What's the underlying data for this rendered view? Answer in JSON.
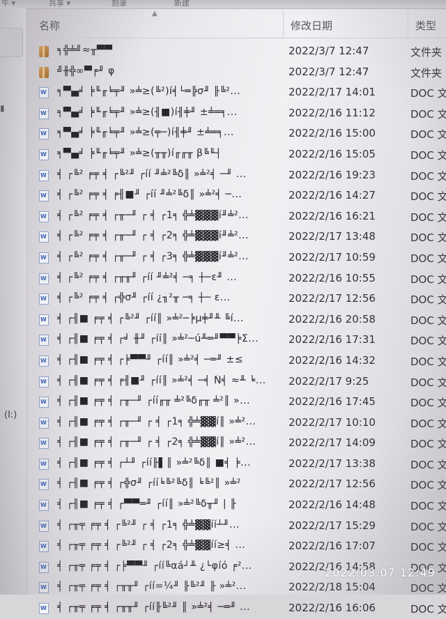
{
  "toolbar": {
    "left_label": "牛 ▾",
    "mid_label": "共享 ▾",
    "mid2_label": "刻录",
    "mid3_label": "新建"
  },
  "nav": {
    "drive_label": "(I:)",
    "mark": "▮"
  },
  "header": {
    "name": "名称",
    "date": "修改日期",
    "type": "类型",
    "sort": "▲"
  },
  "rows": [
    {
      "icon": "folder",
      "name": "╕╬╧╝≈╥▀▀",
      "date": "2022/3/7 12:47",
      "type": "文件夹"
    },
    {
      "icon": "folder",
      "name": "╝╫╬∞▀╒╜ φ",
      "date": "2022/3/7 12:47",
      "type": "文件夹"
    },
    {
      "icon": "doc",
      "name": "╕▀▄╛ ╞╙╓╘╤╜ »╧≥(╚²)í╡└═╠σ╜ ╟╚²...",
      "date": "2022/2/17 14:01",
      "type": "DOC 文档"
    },
    {
      "icon": "doc",
      "name": "╕▀▄╛ ╞╙╓╘╤╜ »╧≥(╢■)í╢╪╜ ±╧═╕...",
      "date": "2022/2/16 11:12",
      "type": "DOC 文档"
    },
    {
      "icon": "doc",
      "name": "╕▀▄╛ ╞╙╓╘╤╜ »╧≥(╤─)í╢╪╜ ±╧═╕...",
      "date": "2022/2/16 15:00",
      "type": "DOC 文档"
    },
    {
      "icon": "doc",
      "name": "╕▀▄╛ ╞╙╓╘╤╜ »╧≥(╥╥)í╓╓╥ β╚╙┤",
      "date": "2022/2/16 15:05",
      "type": "DOC 文档"
    },
    {
      "icon": "doc",
      "name": "╡ ┌╚² ╒╤ ╡ ┌╚²╜ ┌íí ╜╧²╚δ║ »╧²╡ ─╜ ...",
      "date": "2022/2/16 19:23",
      "type": "DOC 文档"
    },
    {
      "icon": "doc",
      "name": "╡ ┌╚² ╒╤ ╡ ╒╢■╜ ┌íí ╜╧²╚δ║ »╧²╡ ─...",
      "date": "2022/2/16 14:27",
      "type": "DOC 文档"
    },
    {
      "icon": "doc",
      "name": "╡ ┌╚² ╒╤ ╡ ┌╥─╜ ┌ ╡ ┌1╕ ╬╧▓▓▓í╜╧²...",
      "date": "2022/2/16 16:21",
      "type": "DOC 文档"
    },
    {
      "icon": "doc",
      "name": "╡ ┌╚² ╒╤ ╡ ┌╥─╜ ┌ ╡ ┌2╕ ╬╧▓▓▓í╜╧²...",
      "date": "2022/2/17 13:48",
      "type": "DOC 文档"
    },
    {
      "icon": "doc",
      "name": "╡ ┌╚² ╒╤ ╡ ┌╥─╜ ┌ ╡ ┌3╕ ╬╧▓▓▓í╜╧²...",
      "date": "2022/2/17 10:59",
      "type": "DOC 文档"
    },
    {
      "icon": "doc",
      "name": "╡ ┌╚² ╒╤ ╡ ┌╥╥╜ ┌íí ╜╧²╡ ─╕ ┼─ε╜ ...",
      "date": "2022/2/16 10:55",
      "type": "DOC 文档"
    },
    {
      "icon": "doc",
      "name": "╡ ┌╚² ╒╤ ╡ ┌╬σ╜ ┌íí ¿╖²╥ ─╕ ┼─ ε...",
      "date": "2022/2/17 12:56",
      "type": "DOC 文档"
    },
    {
      "icon": "doc",
      "name": "╡ ┌╢■ ╒╤ ╡ ┌╚²╜ ┌íí║ »╧²─╞µ╪╜╨ ╚í...",
      "date": "2022/2/16 20:58",
      "type": "DOC 文档"
    },
    {
      "icon": "doc",
      "name": "╡ ┌╢■ ╒╤ ╡ ┌╛ ╫╜ ┌íí║ »╧²─ú╨═╜▀▀╞Σ...",
      "date": "2022/2/16 17:31",
      "type": "DOC 文档"
    },
    {
      "icon": "doc",
      "name": "╡ ┌╢■ ╒╤ ╡ ┌╞▀▀╜ ┌íí║ »╧²╡ ─═╜ ±≤",
      "date": "2022/2/16 14:32",
      "type": "DOC 文档"
    },
    {
      "icon": "doc",
      "name": "╡ ┌╢■ ╒╤ ╡ ╒╢■╜ ┌íí║ »╧²╡ ─╡ Ñ╡ ≈╨ ╘...",
      "date": "2022/2/17 9:25",
      "type": "DOC 文档"
    },
    {
      "icon": "doc",
      "name": "╡ ┌╢■ ╒╤ ╡ ┌╥─╜ ┌íí╓╥ ╧²╚δ╓╥ ╧²║ »...",
      "date": "2022/2/16 17:45",
      "type": "DOC 文档"
    },
    {
      "icon": "doc",
      "name": "╡ ┌╢■ ╒╤ ╡ ┌╥─╜ ┌ ╡ ┌1╕ ╬╧▓▓í║ »╧²...",
      "date": "2022/2/17 10:10",
      "type": "DOC 文档"
    },
    {
      "icon": "doc",
      "name": "╡ ┌╢■ ╒╤ ╡ ┌╥─╜ ┌ ╡ ┌2╕ ╬╧▓▓í║ »╧²...",
      "date": "2022/2/17 14:09",
      "type": "DOC 文档"
    },
    {
      "icon": "doc",
      "name": "╡ ┌╢■ ╒╤ ╡ ┌┴╜ ┌íí╟▌║ »╧²╚δ║ ■╡ ╞...",
      "date": "2022/2/17 13:38",
      "type": "DOC 文档"
    },
    {
      "icon": "doc",
      "name": "╡ ┌╢■ ╒╤ ╡ ┌╬σ╜ ┌íí╘╚²╚δ║ ╘╚²║ »╧²",
      "date": "2022/2/17 12:56",
      "type": "DOC 文档"
    },
    {
      "icon": "doc",
      "name": "╡ ┌╢■ ╒╤ ╡ ┌▀▀═╜ ┌íí║ »╧²╚δ╥╜ | ╟",
      "date": "2022/2/16 14:48",
      "type": "DOC 文档"
    },
    {
      "icon": "doc",
      "name": "╡ ┌╥╤ ╒╤ ╡ ┌╚²╜ ┌ ╡ ┌1╕ ╬╧▓▓íí┴╜...",
      "date": "2022/2/17 15:29",
      "type": "DOC 文档"
    },
    {
      "icon": "doc",
      "name": "╡ ┌╥╤ ╒╤ ╡ ┌╚²╜ ┌ ╡ ┌2╕ ╬╧▓▓íí≥╡ ...",
      "date": "2022/2/16 17:07",
      "type": "DOC 文档"
    },
    {
      "icon": "doc",
      "name": "╡ ┌╥╤ ╒╤ ╡ ┌╞▀▀╜ ┌íí╚αá┘╨ ¿└φíó ╒²...",
      "date": "2022/2/16 14:58",
      "type": "DOC 文档"
    },
    {
      "icon": "doc",
      "name": "╡ ┌╥╤ ╒╤ ╡ ┌╥╥╜ ┌íí=¼╜ ╟╚²╜ ╟ »╧²...",
      "date": "2022/2/18 15:04",
      "type": "DOC 文档"
    },
    {
      "icon": "doc",
      "name": "╡ ┌╥╤ ╒╤ ╡ ┌╥╥╜ ┌íí╟╚²╜ ║ »╧²╡ ─═╜ ...",
      "date": "2022/2/16 16:06",
      "type": "DOC 文档"
    }
  ],
  "stamp": "2022.03.07 12:49",
  "colors": {
    "folder": "#c58a46",
    "doc_icon": "#3d63b5",
    "text": "#28262c"
  }
}
